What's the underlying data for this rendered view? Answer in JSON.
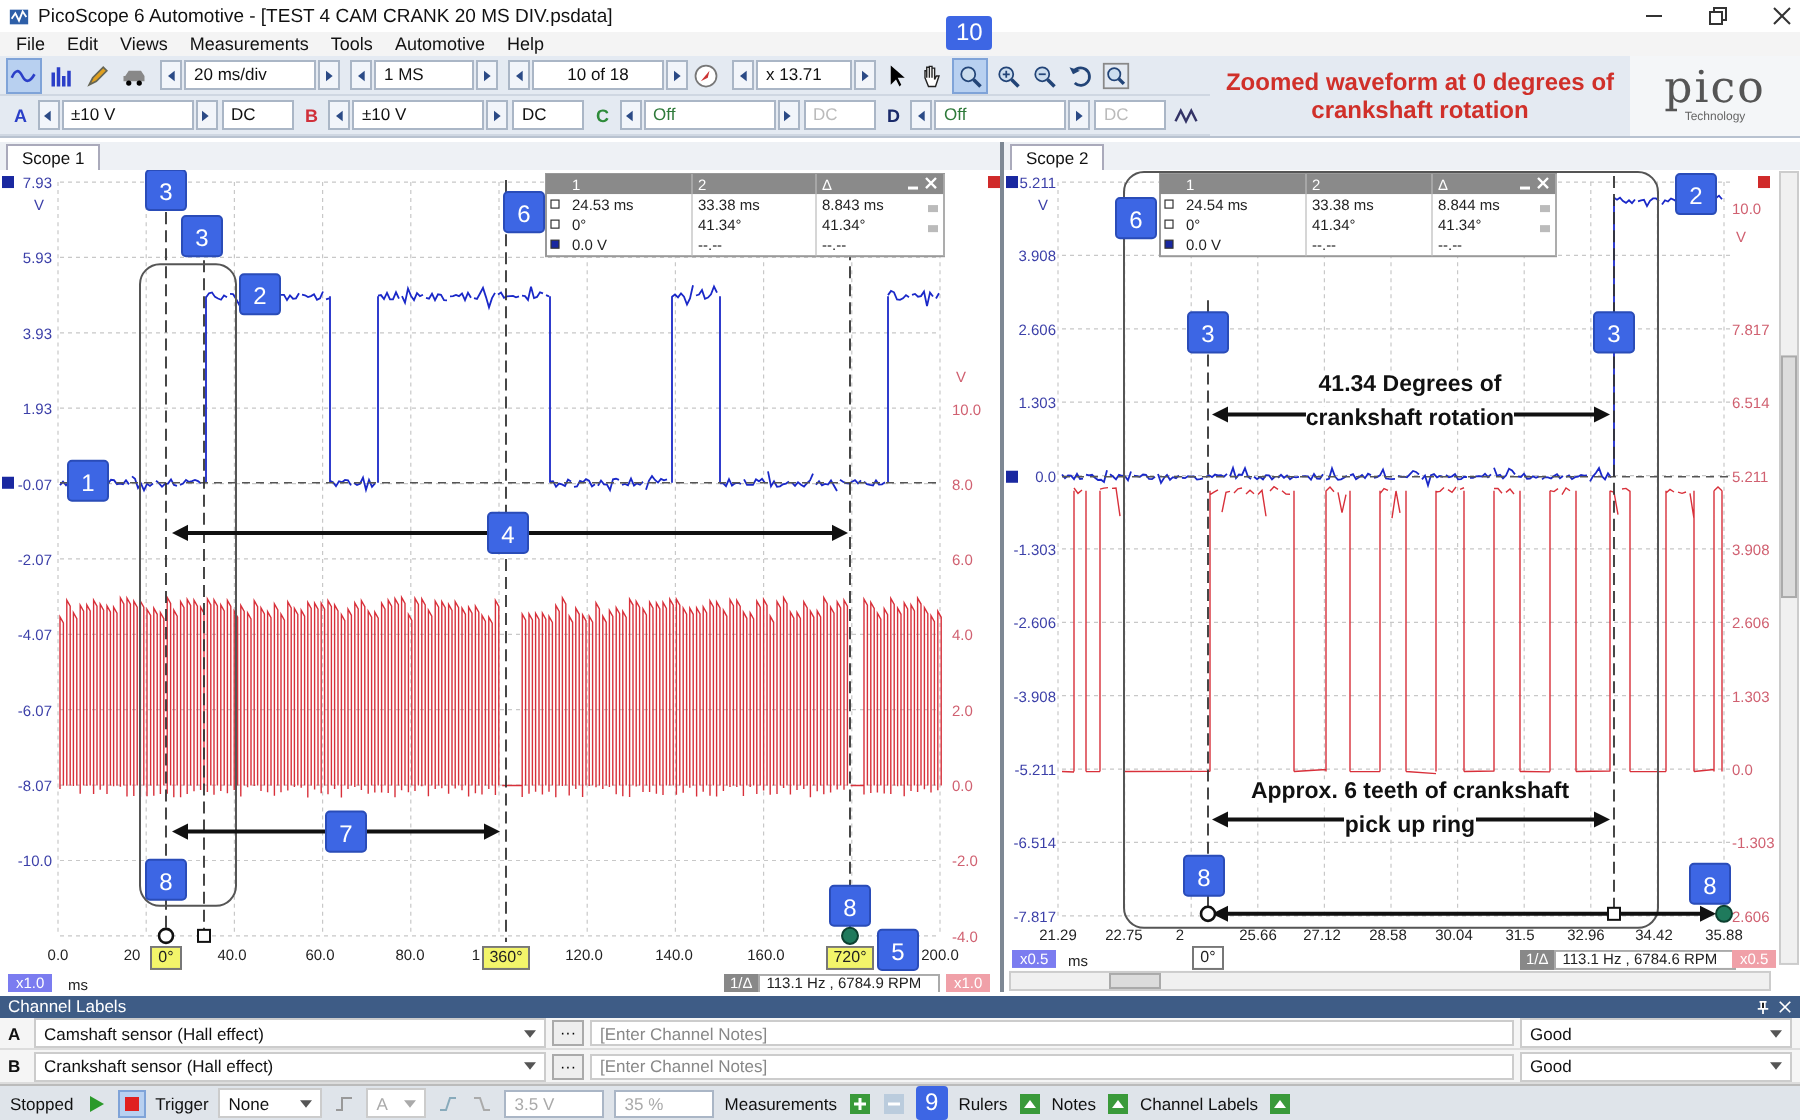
{
  "window": {
    "title": "PicoScope 6 Automotive - [TEST 4 CAM CRANK 20 MS DIV.psdata]"
  },
  "menu": [
    "File",
    "Edit",
    "Views",
    "Measurements",
    "Tools",
    "Automotive",
    "Help"
  ],
  "toolbar": {
    "timebase": "20 ms/div",
    "samples": "1 MS",
    "buffer": "10 of 18",
    "zoom": "x 13.71",
    "callout": "10"
  },
  "channel_bar": [
    {
      "letter": "A",
      "color": "#2b3fc8",
      "range": "±10 V",
      "coupling": "DC",
      "enabled": true
    },
    {
      "letter": "B",
      "color": "#d0303a",
      "range": "±10 V",
      "coupling": "DC",
      "enabled": true
    },
    {
      "letter": "C",
      "color": "#2e8b3a",
      "range": "Off",
      "coupling": "DC",
      "enabled": false
    },
    {
      "letter": "D",
      "color": "#1a2a6a",
      "range": "Off",
      "coupling": "DC",
      "enabled": false
    }
  ],
  "note": "Zoomed waveform at 0 degrees of crankshaft rotation",
  "logo": {
    "name": "pico",
    "tagline": "Technology"
  },
  "scopes": [
    {
      "tab": "Scope 1",
      "left_unit": "V",
      "left_ticks": [
        "7.93",
        "5.93",
        "3.93",
        "1.93",
        "-0.07",
        "-2.07",
        "-4.07",
        "-6.07",
        "-8.07",
        "-10.0"
      ],
      "right_unit": "V",
      "right_ticks": [
        "10.0",
        "8.0",
        "6.0",
        "4.0",
        "2.0",
        "0.0",
        "-2.0",
        "-4.0"
      ],
      "x_ticks": [
        "0.0",
        "20",
        "40.0",
        "60.0",
        "80.0",
        "1",
        "120.0",
        "140.0",
        "160.0",
        "200.0"
      ],
      "x_unit": "ms",
      "left_scale": "x1.0",
      "right_scale": "x1.0",
      "readout_mode": "1/Δ",
      "readout": "113.1 Hz , 6784.9 RPM",
      "table": {
        "header": [
          "1",
          "2",
          "Δ"
        ],
        "rows": [
          [
            "24.53 ms",
            "33.38 ms",
            "8.843 ms"
          ],
          [
            "0°",
            "41.34°",
            "41.34°"
          ],
          [
            "0.0 V",
            "--.--",
            "--.--"
          ]
        ]
      },
      "phase_tags": [
        "0°",
        "360°",
        "720°"
      ],
      "callouts": [
        "3",
        "3",
        "2",
        "1",
        "6",
        "4",
        "7",
        "8",
        "8",
        "5"
      ]
    },
    {
      "tab": "Scope 2",
      "left_unit": "V",
      "left_ticks": [
        "5.211",
        "3.908",
        "2.606",
        "1.303",
        "0.0",
        "-1.303",
        "-2.606",
        "-3.908",
        "-5.211",
        "-6.514",
        "-7.817"
      ],
      "right_unit": "V",
      "right_ticks": [
        "10.0",
        "7.817",
        "6.514",
        "5.211",
        "3.908",
        "2.606",
        "1.303",
        "0.0",
        "-1.303",
        "2.606"
      ],
      "x_ticks": [
        "21.29",
        "22.75",
        "2",
        "25.66",
        "27.12",
        "28.58",
        "30.04",
        "31.5",
        "32.96",
        "34.42",
        "35.88"
      ],
      "x_unit": "ms",
      "left_scale": "x0.5",
      "right_scale": "x0.5",
      "readout_mode": "1/Δ",
      "readout": "113.1 Hz , 6784.6 RPM",
      "table": {
        "header": [
          "1",
          "2",
          "Δ"
        ],
        "rows": [
          [
            "24.54 ms",
            "33.38 ms",
            "8.844 ms"
          ],
          [
            "0°",
            "41.34°",
            "41.34°"
          ],
          [
            "0.0 V",
            "--.--",
            "--.--"
          ]
        ]
      },
      "phase_tags": [
        "0°"
      ],
      "callouts": [
        "6",
        "2",
        "3",
        "3",
        "8",
        "8"
      ],
      "annotations": [
        {
          "lines": [
            "**41.34** Degrees of",
            "crankshaft rotation"
          ]
        },
        {
          "lines": [
            "Approx. 6 teeth of crankshaft",
            "pick up ring"
          ]
        }
      ]
    }
  ],
  "channel_labels": {
    "title": "Channel Labels",
    "rows": [
      {
        "channel": "A",
        "label": "Camshaft sensor (Hall effect)",
        "button": "···",
        "placeholder": "[Enter Channel Notes]",
        "rating": "Good"
      },
      {
        "channel": "B",
        "label": "Crankshaft sensor (Hall effect)",
        "button": "···",
        "placeholder": "[Enter Channel Notes]",
        "rating": "Good"
      }
    ]
  },
  "status_bar": {
    "state": "Stopped",
    "trigger_label": "Trigger",
    "trigger_mode": "None",
    "trigger_channel": "A",
    "threshold": "3.5 V",
    "pretrigger": "35 %",
    "measurements": "Measurements",
    "callout": "9",
    "rulers": "Rulers",
    "notes": "Notes",
    "channel_labels": "Channel Labels"
  }
}
